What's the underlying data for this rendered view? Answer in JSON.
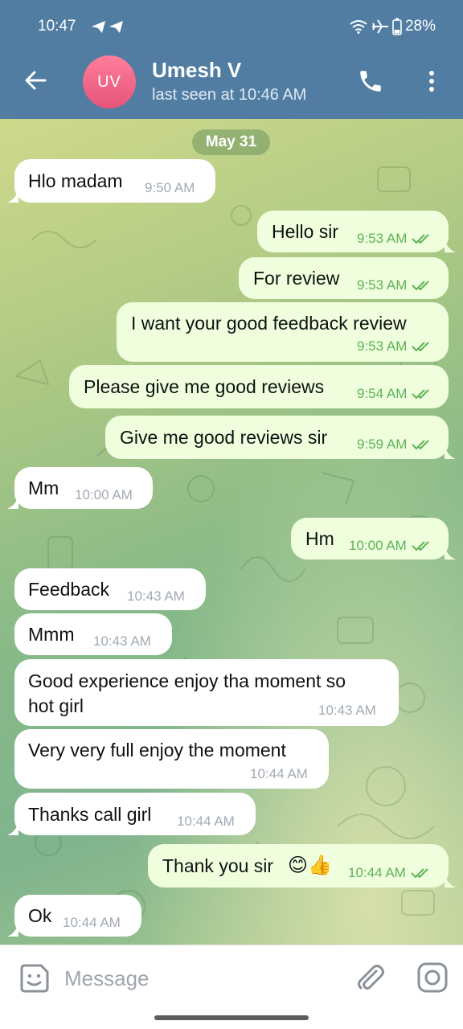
{
  "status_bar": {
    "time": "10:47",
    "battery": "28%"
  },
  "header": {
    "avatar_initials": "UV",
    "name": "Umesh V",
    "status": "last seen at 10:46 AM"
  },
  "chat": {
    "date_label": "May 31",
    "messages": [
      {
        "dir": "in",
        "text": "Hlo madam",
        "time": "9:50 AM"
      },
      {
        "dir": "out",
        "text": "Hello sir",
        "time": "9:53 AM"
      },
      {
        "dir": "out",
        "text": "For review",
        "time": "9:53 AM"
      },
      {
        "dir": "out",
        "text": "I want your good feedback review",
        "time": "9:53 AM"
      },
      {
        "dir": "out",
        "text": "Please give me good reviews",
        "time": "9:54 AM"
      },
      {
        "dir": "out",
        "text": "Give me good reviews sir",
        "time": "9:59 AM"
      },
      {
        "dir": "in",
        "text": "Mm",
        "time": "10:00 AM"
      },
      {
        "dir": "out",
        "text": "Hm",
        "time": "10:00 AM"
      },
      {
        "dir": "in",
        "text": "Feedback",
        "time": "10:43 AM"
      },
      {
        "dir": "in",
        "text": "Mmm",
        "time": "10:43 AM"
      },
      {
        "dir": "in",
        "text": "Good experience enjoy tha moment so",
        "text2": "hot girl",
        "time": "10:43 AM"
      },
      {
        "dir": "in",
        "text": "Very very full enjoy the moment",
        "time": "10:44 AM"
      },
      {
        "dir": "in",
        "text": "Thanks call girl",
        "time": "10:44 AM"
      },
      {
        "dir": "out",
        "text": "Thank you sir",
        "emoji": "😊👍",
        "time": "10:44 AM"
      },
      {
        "dir": "in",
        "text": "Ok",
        "time": "10:44 AM"
      }
    ]
  },
  "input": {
    "placeholder": "Message"
  },
  "colors": {
    "header": "#517da2",
    "bubble_in": "#ffffff",
    "bubble_out": "#efffde",
    "check_green": "#5fb157"
  }
}
